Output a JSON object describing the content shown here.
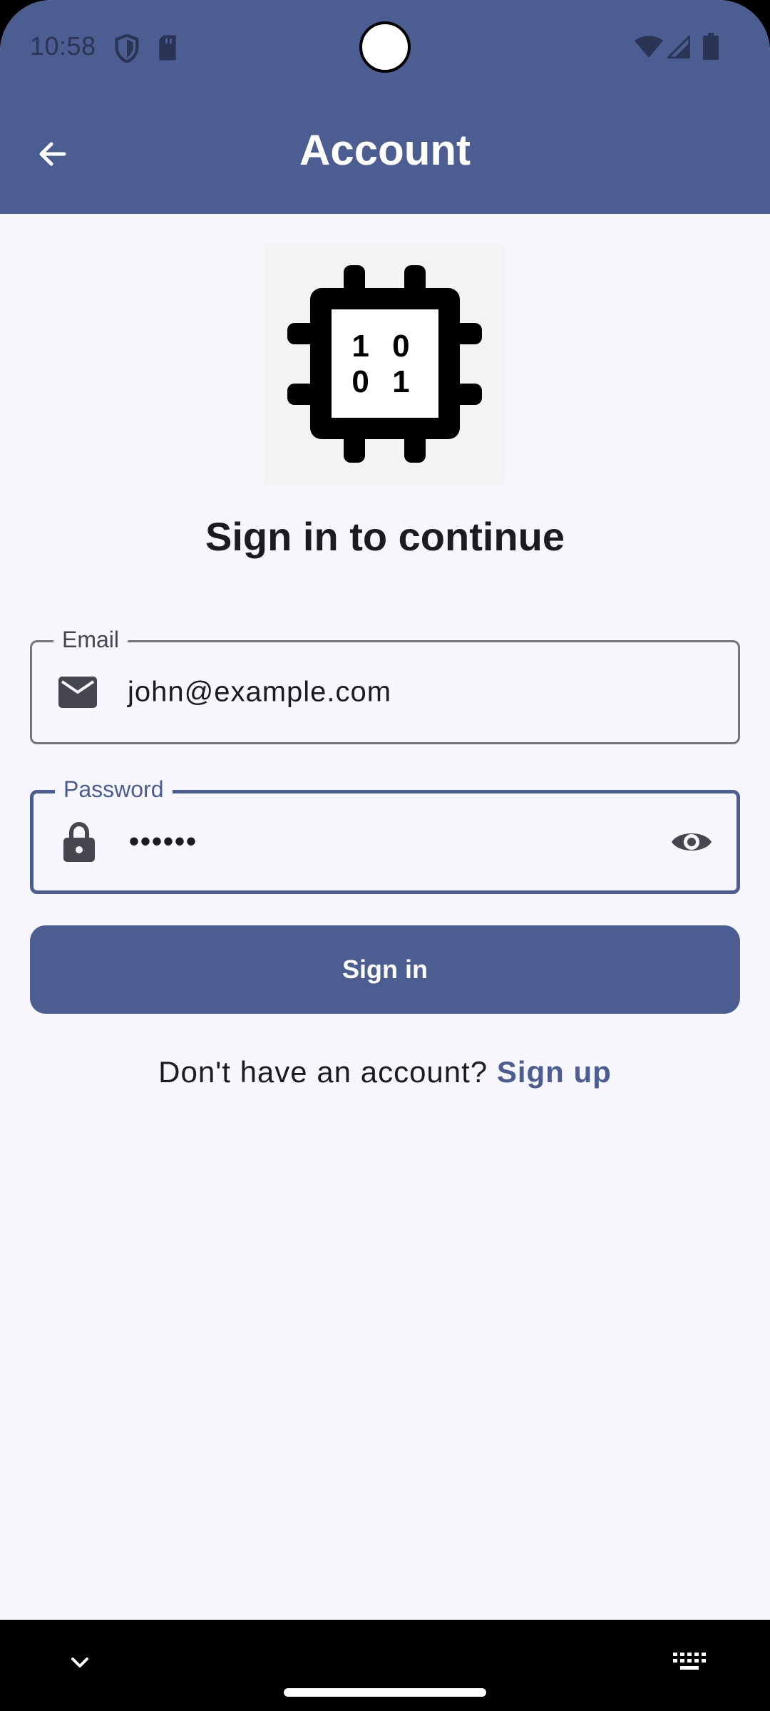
{
  "status_bar": {
    "time": "10:58",
    "icons": [
      "shield-icon",
      "sd-card-icon",
      "wifi-icon",
      "cellular-signal-icon",
      "battery-icon"
    ]
  },
  "app_bar": {
    "title": "Account",
    "back_icon": "arrow-left-icon"
  },
  "logo": {
    "name": "chip-binary-logo",
    "row1": "1 0",
    "row2": "0 1"
  },
  "heading": "Sign in to continue",
  "email_field": {
    "label": "Email",
    "value": "john@example.com",
    "icon": "mail-icon"
  },
  "password_field": {
    "label": "Password",
    "value": "••••••",
    "icon": "lock-icon",
    "trailing_icon": "eye-icon",
    "focused": true
  },
  "sign_in_button": {
    "label": "Sign in"
  },
  "signup_prompt": {
    "text": "Don't have an account? ",
    "link": "Sign up"
  },
  "nav_bar": {
    "icons": [
      "chevron-down-icon",
      "keyboard-icon"
    ]
  },
  "colors": {
    "primary": "#4c5d92",
    "background": "#f7f6fc",
    "on_surface": "#1c1b1f",
    "outline": "#75757a"
  }
}
